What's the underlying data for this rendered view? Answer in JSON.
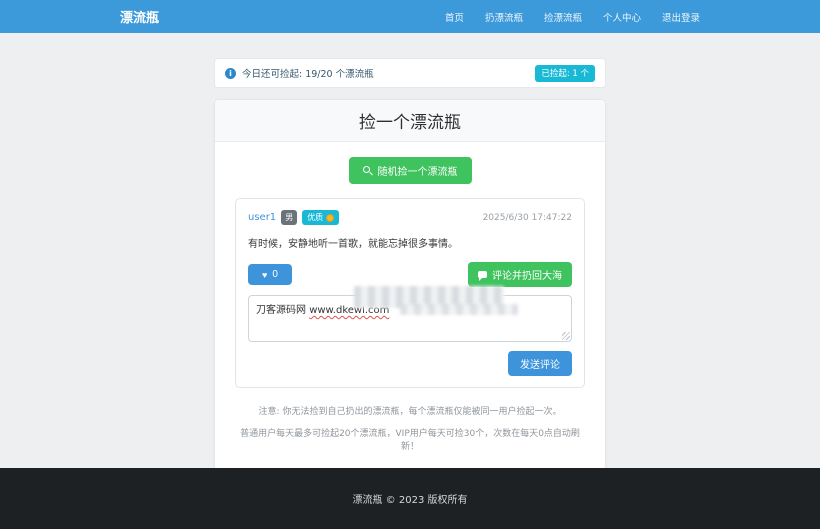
{
  "navbar": {
    "brand": "漂流瓶",
    "items": [
      "首页",
      "扔漂流瓶",
      "捡漂流瓶",
      "个人中心",
      "退出登录"
    ]
  },
  "alert": {
    "text": "今日还可捡起: 19/20 个漂流瓶",
    "badge": "已捡起: 1 个"
  },
  "pick_card": {
    "title": "捡一个漂流瓶",
    "random_button": "随机捡一个漂流瓶"
  },
  "bottle": {
    "username": "user1",
    "gender_badge": "男",
    "type_badge": "优质",
    "timestamp": "2025/6/30 17:47:22",
    "content": "有时候，安静地听一首歌，就能忘掉很多事情。",
    "like_count": "0",
    "comment_button": "评论并扔回大海",
    "comment_text": "刀客源码网 ",
    "comment_url": "www.dkewl.com",
    "send_button": "发送评论"
  },
  "notes": [
    "注意: 你无法捡到自己扔出的漂流瓶，每个漂流瓶仅能被同一用户捡起一次。",
    "普通用户每天最多可捡起20个漂流瓶，VIP用户每天可捡30个，次数在每天0点自动刷新！"
  ],
  "footer": {
    "text": "漂流瓶 © 2023 版权所有"
  },
  "colors": {
    "navbar_bg": "#3c99da",
    "primary_blue": "#3d94db",
    "success_green": "#3ec35e",
    "info_cyan": "#19b9d6",
    "badge_gray": "#6b7278",
    "page_bg": "#edeff1",
    "footer_bg": "#1e2124"
  }
}
